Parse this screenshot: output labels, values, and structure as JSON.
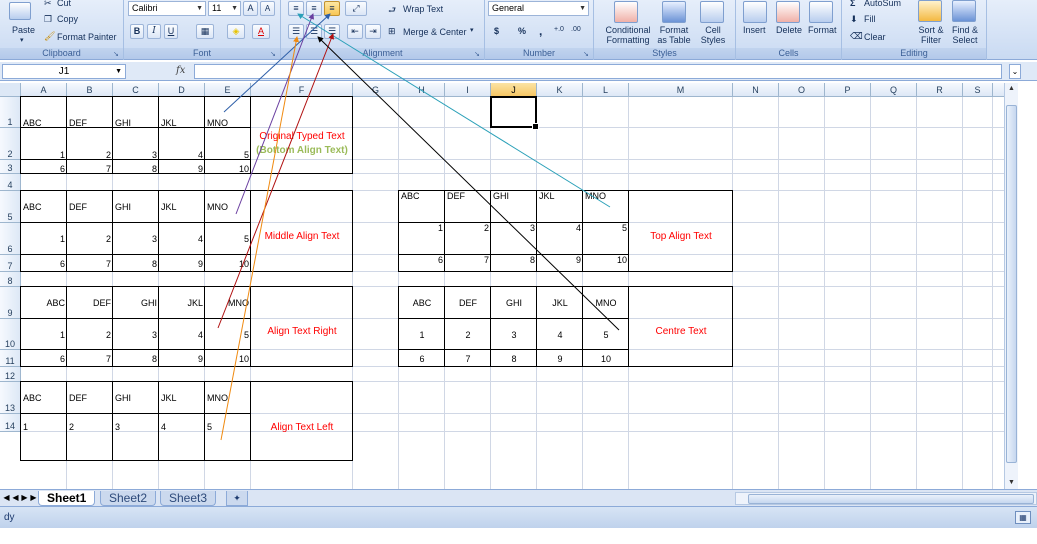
{
  "ribbon": {
    "clipboard": {
      "label": "Clipboard",
      "paste": "Paste",
      "cut": "Cut",
      "copy": "Copy",
      "format_painter": "Format Painter"
    },
    "font": {
      "label": "Font",
      "font_name": "Calibri",
      "font_size": "11",
      "bold": "B",
      "italic": "I",
      "underline": "U"
    },
    "alignment": {
      "label": "Alignment",
      "wrap_text": "Wrap Text",
      "merge_center": "Merge & Center"
    },
    "number": {
      "label": "Number",
      "format": "General",
      "currency": "$",
      "percent": "%",
      "comma": ","
    },
    "styles": {
      "label": "Styles",
      "conditional": "Conditional Formatting",
      "format_table": "Format as Table",
      "cell_styles": "Cell Styles"
    },
    "cells": {
      "label": "Cells",
      "insert": "Insert",
      "delete": "Delete",
      "format": "Format"
    },
    "editing": {
      "label": "Editing",
      "autosum": "AutoSum",
      "fill": "Fill",
      "clear": "Clear",
      "sort_filter": "Sort & Filter",
      "find_select": "Find & Select"
    }
  },
  "formula_bar": {
    "name_box": "J1",
    "fx": "fx",
    "value": ""
  },
  "columns": [
    "A",
    "B",
    "C",
    "D",
    "E",
    "F",
    "G",
    "H",
    "I",
    "J",
    "K",
    "L",
    "M",
    "N",
    "O",
    "P",
    "Q",
    "R",
    "S"
  ],
  "selected_column": "J",
  "rows": [
    "1",
    "2",
    "3",
    "4",
    "5",
    "6",
    "7",
    "8",
    "9",
    "10",
    "11",
    "12",
    "13",
    "14"
  ],
  "table_headers": [
    "ABC",
    "DEF",
    "GHI",
    "JKL",
    "MNO"
  ],
  "row_values_1": [
    "1",
    "2",
    "3",
    "4",
    "5"
  ],
  "row_values_2": [
    "6",
    "7",
    "8",
    "9",
    "10"
  ],
  "labels": {
    "original": "Original Typed Text",
    "bottom": "(Bottom Align Text)",
    "middle": "Middle Align Text",
    "top": "Top Align Text",
    "right": "Align Text Right",
    "centre": "Centre Text",
    "left": "Align Text Left"
  },
  "sheets": [
    "Sheet1",
    "Sheet2",
    "Sheet3"
  ],
  "active_sheet": "Sheet1",
  "status": "dy",
  "colors": {
    "annotation_red": "#ff0000",
    "annotation_green": "#9bbb59",
    "ribbon": "#c9daf2",
    "selected_header": "#f6c560"
  }
}
